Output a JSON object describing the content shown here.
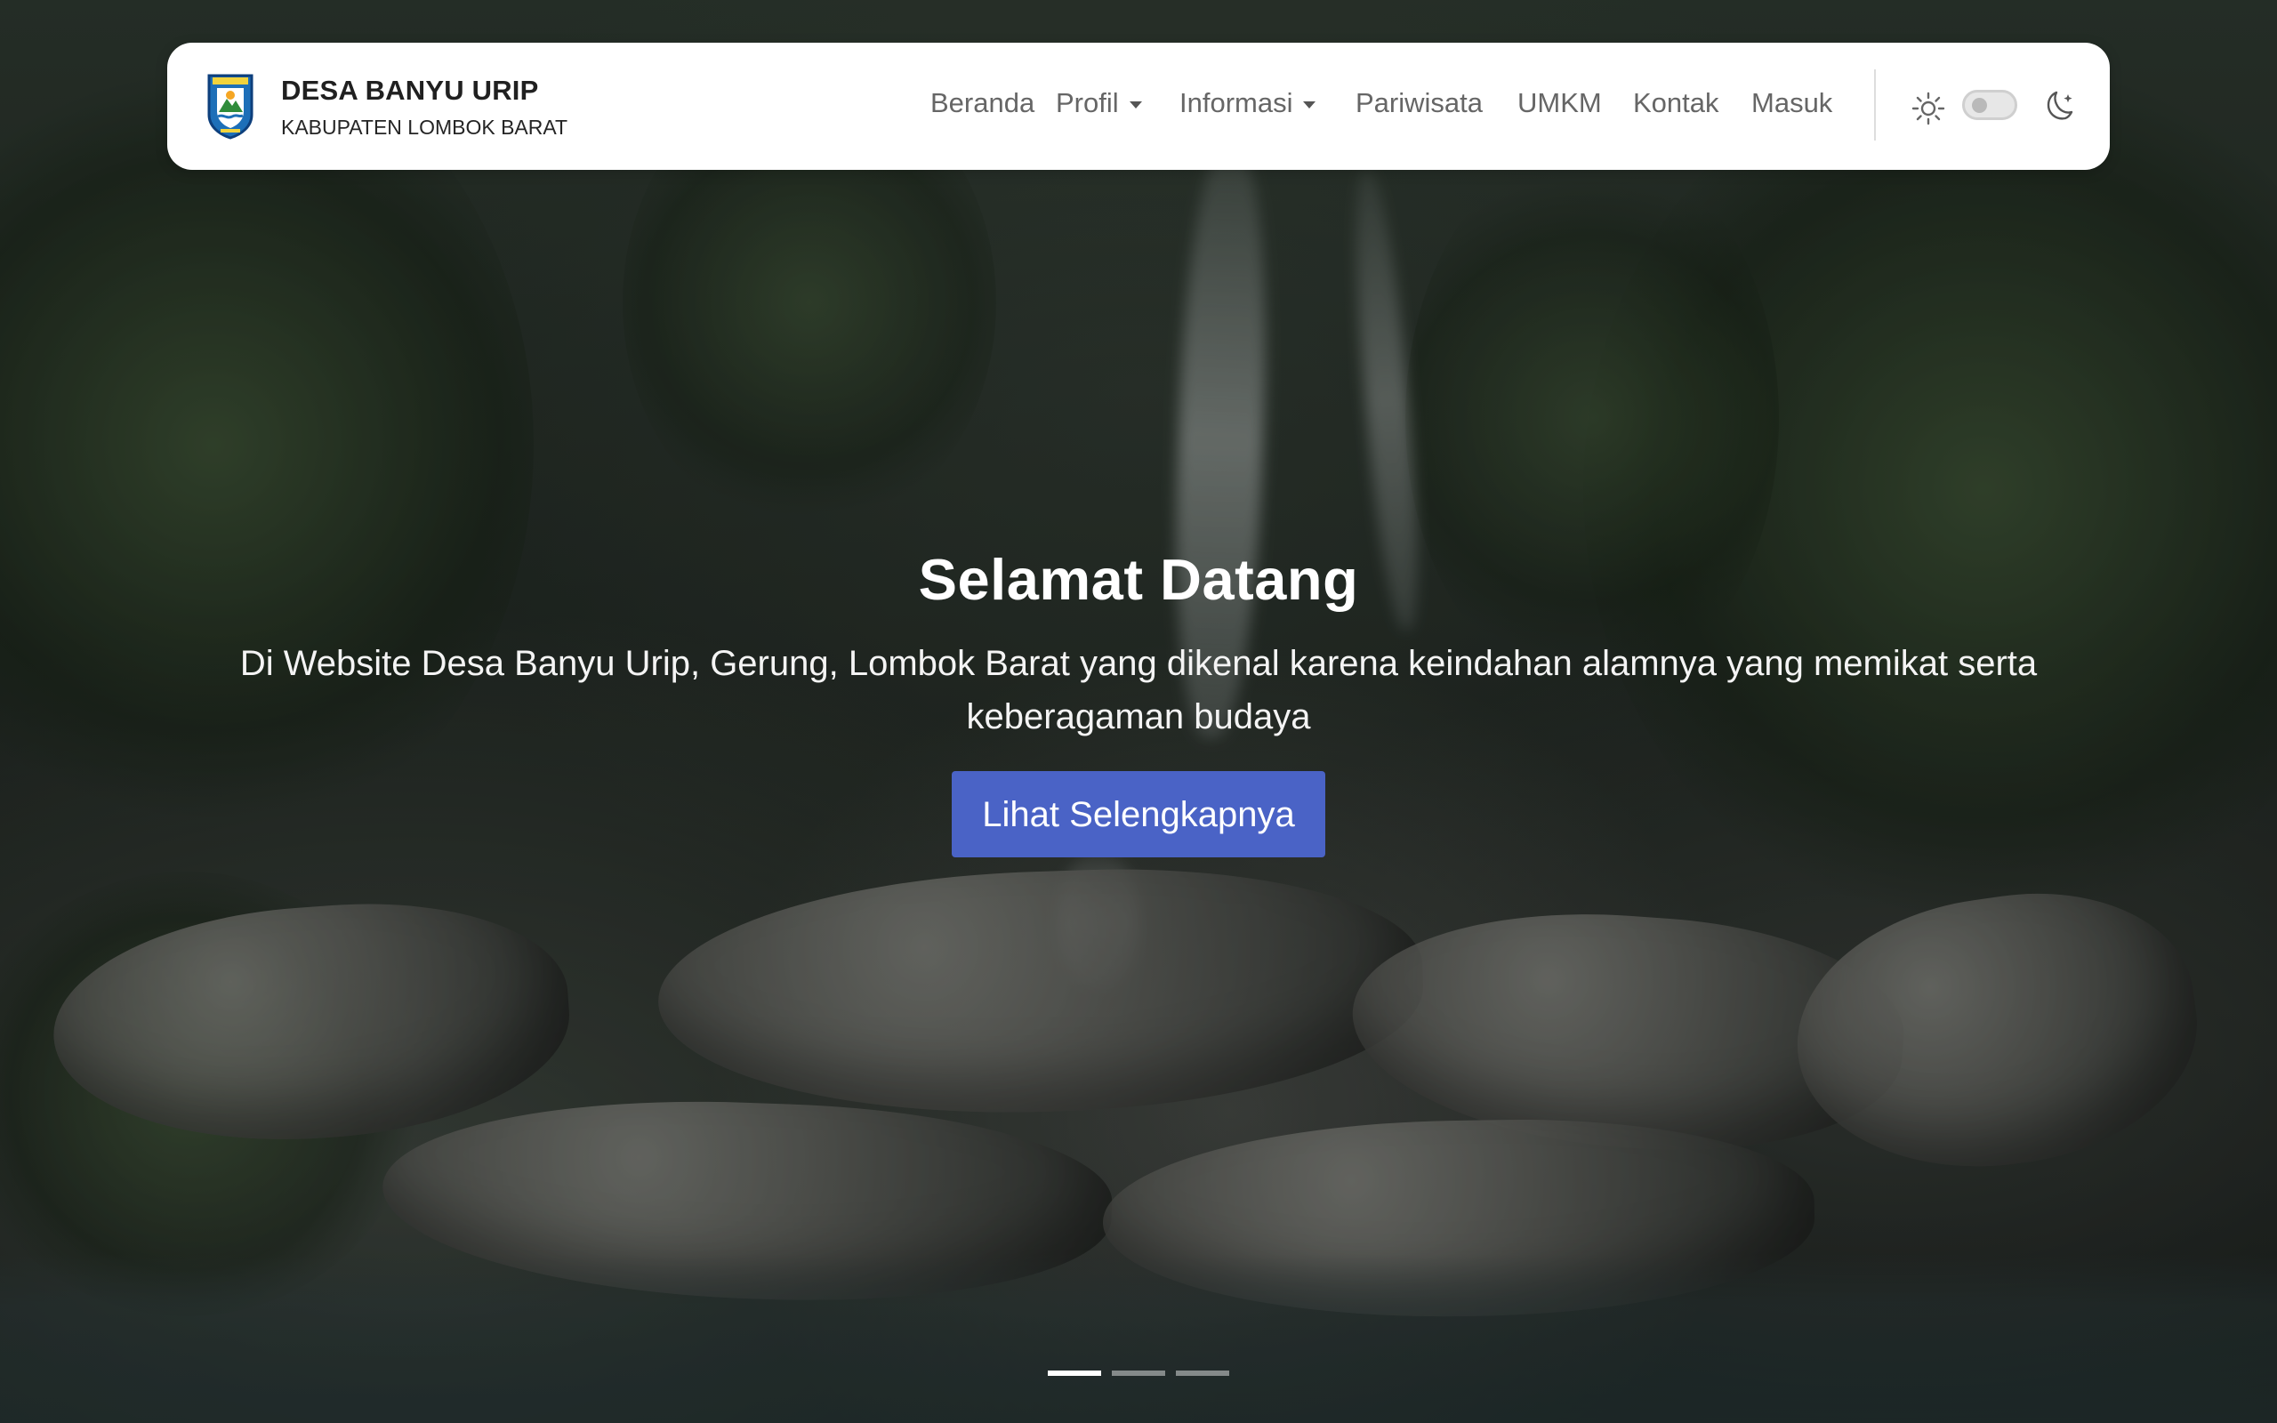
{
  "header": {
    "brand_title": "DESA BANYU URIP",
    "brand_subtitle": "KABUPATEN LOMBOK BARAT",
    "logo_icon": "village-emblem-icon"
  },
  "nav": {
    "items": [
      {
        "label": "Beranda",
        "has_dropdown": false
      },
      {
        "label": "Profil",
        "has_dropdown": true
      },
      {
        "label": "Informasi",
        "has_dropdown": true
      },
      {
        "label": "Pariwisata",
        "has_dropdown": false
      },
      {
        "label": "UMKM",
        "has_dropdown": false
      },
      {
        "label": "Kontak",
        "has_dropdown": false
      },
      {
        "label": "Masuk",
        "has_dropdown": false
      }
    ]
  },
  "theme_controls": {
    "light_icon": "sun-icon",
    "toggle_state": "off",
    "dark_icon": "moon-icon"
  },
  "hero": {
    "title": "Selamat Datang",
    "description": "Di Website Desa Banyu Urip, Gerung, Lombok Barat yang dikenal karena keindahan alamnya yang memikat serta keberagaman budaya",
    "button_label": "Lihat Selengkapnya",
    "background": "waterfall-forest"
  },
  "carousel": {
    "active_slide": 1,
    "slide_count": 3
  },
  "colors": {
    "navbar_background": "#ffffff",
    "button_primary": "#4a63c6",
    "hero_text": "#ffffff"
  }
}
